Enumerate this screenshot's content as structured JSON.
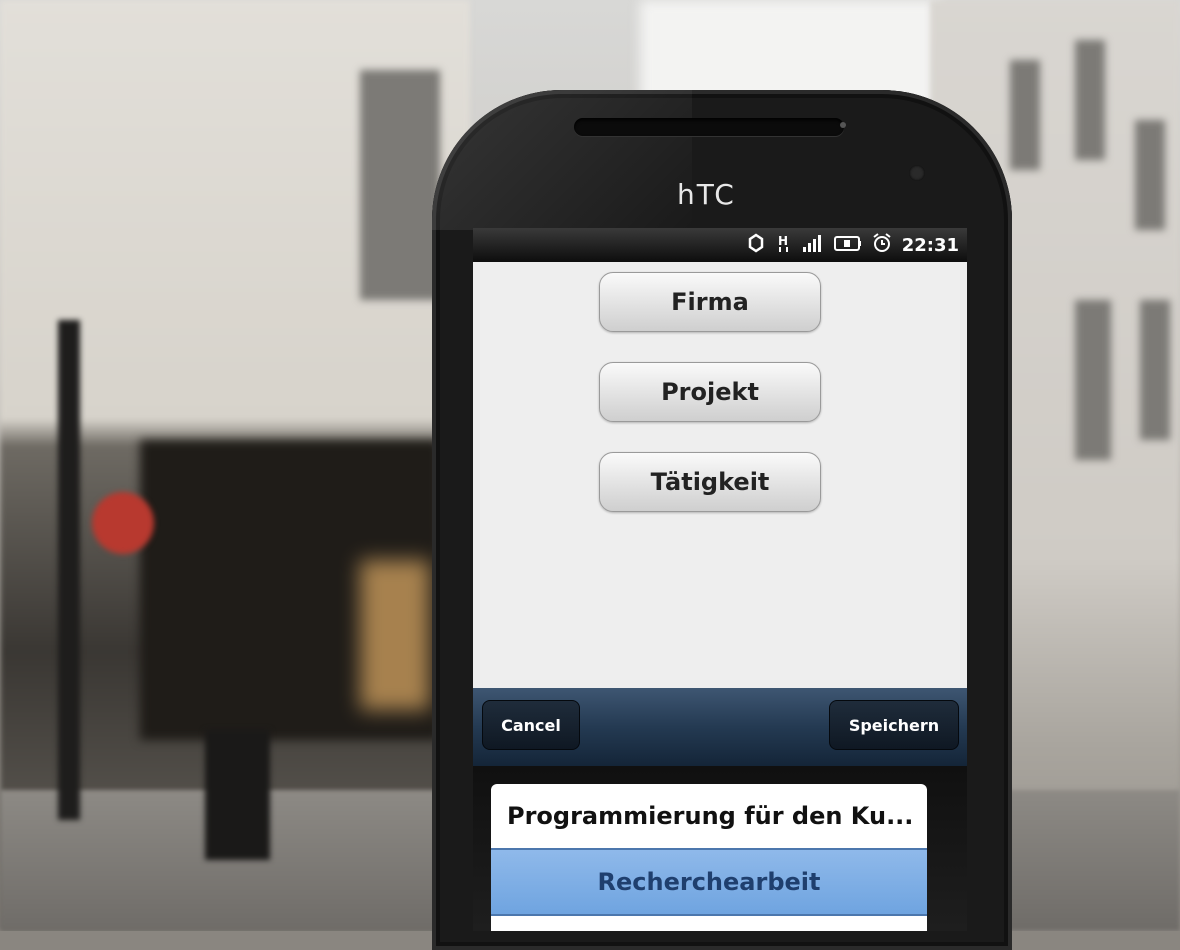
{
  "device": {
    "brand": "hTC"
  },
  "status_bar": {
    "time": "22:31",
    "icons": [
      "sync-icon",
      "data-h-icon",
      "signal-icon",
      "battery-icon",
      "alarm-icon"
    ]
  },
  "main": {
    "buttons": [
      {
        "label": "Firma"
      },
      {
        "label": "Projekt"
      },
      {
        "label": "Tätigkeit"
      }
    ]
  },
  "toolbar": {
    "cancel_label": "Cancel",
    "save_label": "Speichern"
  },
  "picker": {
    "items": [
      "Programmierung für den Ku...",
      "Recherchearbeit"
    ],
    "selected": "Recherchearbeit"
  },
  "colors": {
    "toolbar": "#243a52",
    "selection": "#7fb0e8",
    "screen_bg": "#eeeeee"
  }
}
